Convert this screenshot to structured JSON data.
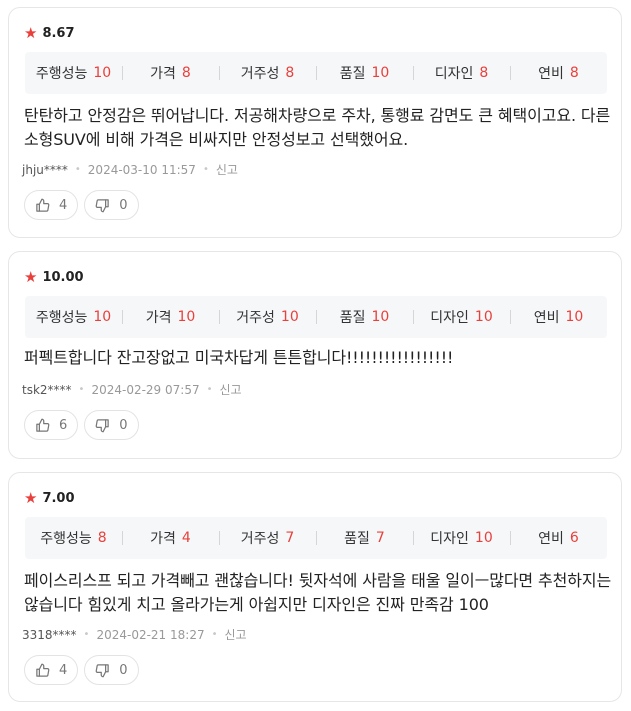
{
  "reviews": [
    {
      "rating": "8.67",
      "attributes": [
        {
          "label": "주행성능",
          "score": "10"
        },
        {
          "label": "가격",
          "score": "8"
        },
        {
          "label": "거주성",
          "score": "8"
        },
        {
          "label": "품질",
          "score": "10"
        },
        {
          "label": "디자인",
          "score": "8"
        },
        {
          "label": "연비",
          "score": "8"
        }
      ],
      "text": "탄탄하고 안정감은 뛰어납니다. 저공해차량으로 주차, 통행료 감면도 큰 혜택이고요. 다른 소형SUV에 비해 가격은 비싸지만 안정성보고 선택했어요.",
      "user": "jhju****",
      "date": "2024-03-10 11:57",
      "report_label": "신고",
      "likes": "4",
      "dislikes": "0"
    },
    {
      "rating": "10.00",
      "attributes": [
        {
          "label": "주행성능",
          "score": "10"
        },
        {
          "label": "가격",
          "score": "10"
        },
        {
          "label": "거주성",
          "score": "10"
        },
        {
          "label": "품질",
          "score": "10"
        },
        {
          "label": "디자인",
          "score": "10"
        },
        {
          "label": "연비",
          "score": "10"
        }
      ],
      "text": "퍼펙트합니다 잔고장없고 미국차답게 튼튼합니다!!!!!!!!!!!!!!!!!",
      "user": "tsk2****",
      "date": "2024-02-29 07:57",
      "report_label": "신고",
      "likes": "6",
      "dislikes": "0"
    },
    {
      "rating": "7.00",
      "attributes": [
        {
          "label": "주행성능",
          "score": "8"
        },
        {
          "label": "가격",
          "score": "4"
        },
        {
          "label": "거주성",
          "score": "7"
        },
        {
          "label": "품질",
          "score": "7"
        },
        {
          "label": "디자인",
          "score": "10"
        },
        {
          "label": "연비",
          "score": "6"
        }
      ],
      "text": "페이스리스프 되고 가격빼고 괜찮습니다! 뒷자석에 사람을 태울 일이ㅡ많다면 추천하지는 않습니다 힘있게 치고 올라가는게 아쉽지만 디자인은 진짜 만족감 100",
      "user": "3318****",
      "date": "2024-02-21 18:27",
      "report_label": "신고",
      "likes": "4",
      "dislikes": "0"
    }
  ],
  "colors": {
    "accent": "#e8413c",
    "attr_bg": "#f6f7f9",
    "border": "#e6e6e6"
  },
  "icons": {
    "star": "star-icon",
    "like": "thumbs-up-icon",
    "dislike": "thumbs-down-icon"
  }
}
